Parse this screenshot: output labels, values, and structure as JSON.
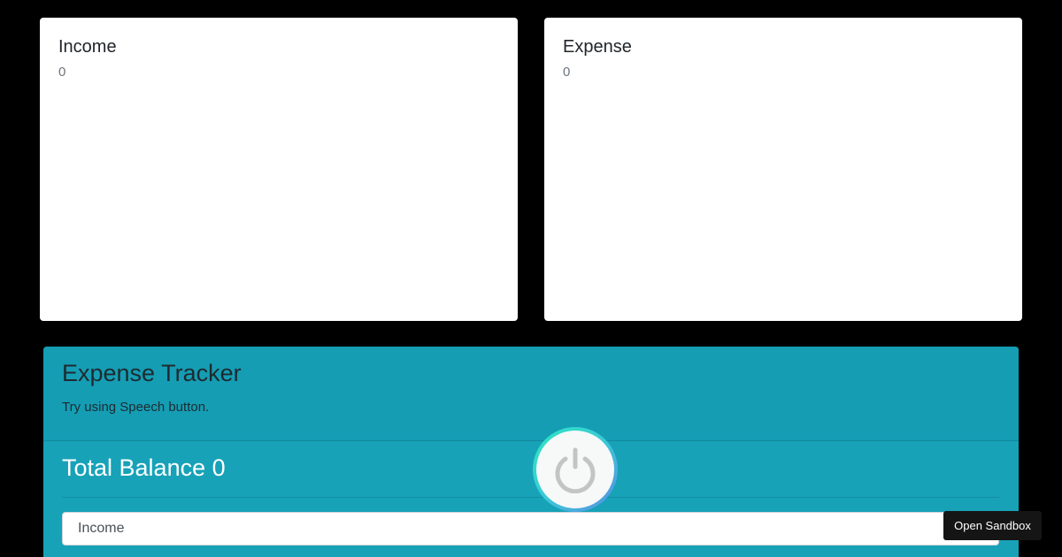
{
  "income_card": {
    "title": "Income",
    "value": "0"
  },
  "expense_card": {
    "title": "Expense",
    "value": "0"
  },
  "tracker": {
    "title": "Expense Tracker",
    "subtitle": "Try using Speech button.",
    "balance": "Total Balance 0",
    "type_select": {
      "selected": "Income"
    }
  },
  "speech_button": {
    "icon": "power-icon"
  },
  "sandbox_button": {
    "label": "Open Sandbox"
  },
  "colors": {
    "background": "#000000",
    "tracker_bg": "#17a2b8",
    "card_bg": "#ffffff",
    "sandbox_bg": "#151515"
  }
}
